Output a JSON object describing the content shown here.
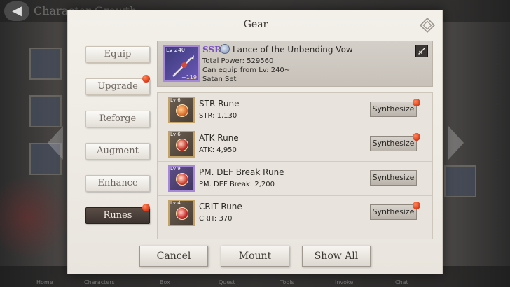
{
  "background": {
    "screen_title": "Character Growth",
    "nav_items": [
      "Home",
      "Characters",
      "Box",
      "Quest",
      "Tools",
      "Invoke",
      "Chat"
    ],
    "back_icon": "back-arrow-icon"
  },
  "dialog": {
    "title": "Gear",
    "help_icon": "diamond-help-icon"
  },
  "tabs": [
    {
      "label": "Equip",
      "active": false,
      "badge": false
    },
    {
      "label": "Upgrade",
      "active": false,
      "badge": true
    },
    {
      "label": "Reforge",
      "active": false,
      "badge": false
    },
    {
      "label": "Augment",
      "active": false,
      "badge": false
    },
    {
      "label": "Enhance",
      "active": false,
      "badge": false
    },
    {
      "label": "Runes",
      "active": true,
      "badge": true
    }
  ],
  "item": {
    "level": "Lv 240",
    "plus": "+119",
    "rarity": "SSR",
    "name": "Lance of the Unbending Vow",
    "power": "Total Power: 529560",
    "equip_req": "Can equip from Lv: 240~",
    "set": "Satan Set",
    "icon": "lance-icon",
    "rarity_color": "#7a4fc4"
  },
  "runes": [
    {
      "level": "Lv 6",
      "name": "STR Rune",
      "stat": "STR: 1,130",
      "button": "Synthesize",
      "badge": true,
      "frame": "gold"
    },
    {
      "level": "Lv 6",
      "name": "ATK Rune",
      "stat": "ATK: 4,950",
      "button": "Synthesize",
      "badge": true,
      "frame": "gold"
    },
    {
      "level": "Lv 9",
      "name": "PM. DEF Break Rune",
      "stat": "PM. DEF Break: 2,200",
      "button": "Synthesize",
      "badge": false,
      "frame": "purple"
    },
    {
      "level": "Lv 4",
      "name": "CRIT Rune",
      "stat": "CRIT: 370",
      "button": "Synthesize",
      "badge": true,
      "frame": "gold"
    }
  ],
  "buttons": {
    "cancel": "Cancel",
    "mount": "Mount",
    "show_all": "Show All"
  },
  "colors": {
    "badge": "#e0401c",
    "active_tab": "#3c322e"
  }
}
